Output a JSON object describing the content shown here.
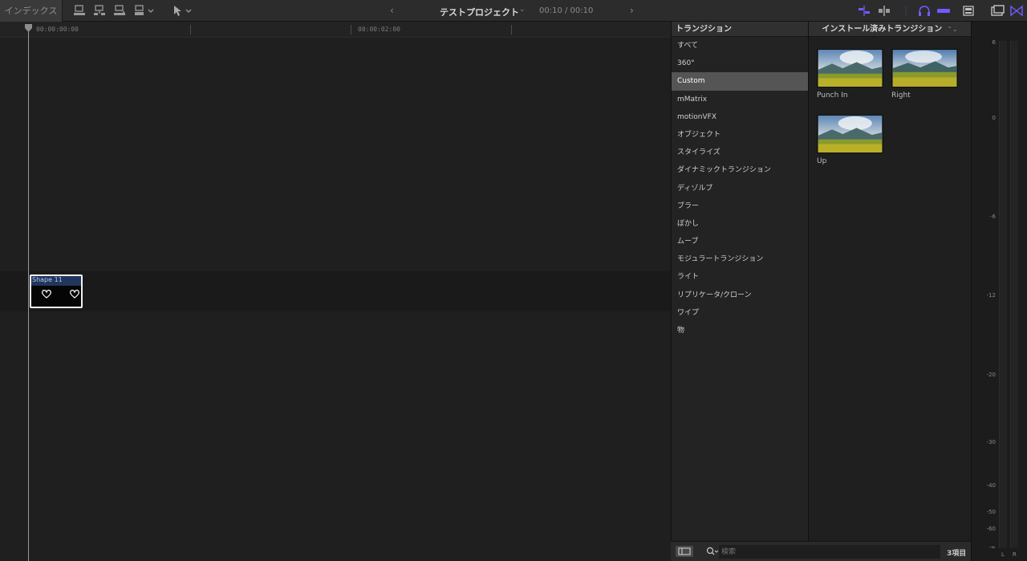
{
  "toolbar": {
    "index_label": "インデックス",
    "project_title": "テストプロジェクト",
    "timecode": "00:10 / 00:10",
    "prev_arrow": "‹",
    "next_arrow": "›",
    "accent_color": "#6f5cff"
  },
  "timeline": {
    "ruler": [
      "00:00:00:00",
      "00:00:02:00"
    ],
    "clip": {
      "name": "Shape 11",
      "color": "#21355e"
    }
  },
  "categories": {
    "header": "トランジション",
    "items": [
      "すべて",
      "360°",
      "Custom",
      "mMatrix",
      "motionVFX",
      "オブジェクト",
      "スタイライズ",
      "ダイナミックトランジション",
      "ディゾルブ",
      "ブラー",
      "ぼかし",
      "ムーブ",
      "モジュラートランジション",
      "ライト",
      "リプリケータ/クローン",
      "ワイプ",
      "物"
    ],
    "selected": "Custom"
  },
  "browser": {
    "header": "インストール済みトランジション",
    "header_arrows": "⌃⌄",
    "thumbnails": [
      {
        "label": "Punch In",
        "icon": "landscape-thumbnail"
      },
      {
        "label": "Right",
        "icon": "landscape-thumbnail"
      },
      {
        "label": "Up",
        "icon": "landscape-thumbnail"
      }
    ],
    "search_placeholder": "検索",
    "item_count": "3項目"
  },
  "meter": {
    "scale": [
      "6",
      "0",
      "-6",
      "-12",
      "-20",
      "-30",
      "-40",
      "-50",
      "-60",
      "-∞"
    ],
    "channels": [
      "L",
      "R"
    ]
  }
}
